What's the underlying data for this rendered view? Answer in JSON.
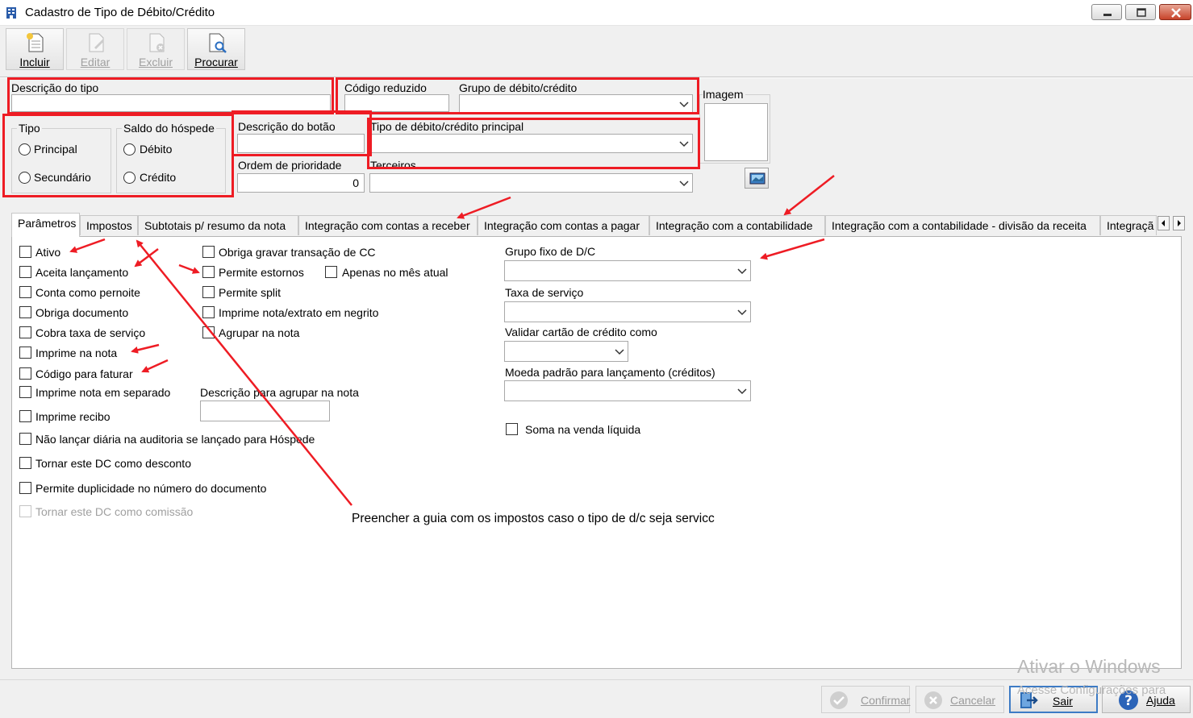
{
  "window": {
    "title": "Cadastro de Tipo de Débito/Crédito"
  },
  "toolbar": {
    "incluir": "Incluir",
    "editar": "Editar",
    "excluir": "Excluir",
    "procurar": "Procurar"
  },
  "form": {
    "descricao_tipo_label": "Descrição do tipo",
    "descricao_tipo_value": "",
    "codigo_reduzido_label": "Código reduzido",
    "codigo_reduzido_value": "",
    "grupo_label": "Grupo de débito/crédito",
    "grupo_value": "",
    "imagem_label": "Imagem",
    "tipo_label": "Tipo",
    "tipo_options": [
      "Principal",
      "Secundário"
    ],
    "saldo_label": "Saldo do hóspede",
    "saldo_options": [
      "Débito",
      "Crédito"
    ],
    "descricao_botao_label": "Descrição do botão",
    "descricao_botao_value": "",
    "tipo_principal_label": "Tipo de débito/crédito principal",
    "tipo_principal_value": "",
    "ordem_label": "Ordem de prioridade",
    "ordem_value": "0",
    "terceiros_label": "Terceiros",
    "terceiros_value": ""
  },
  "tabs": [
    "Parâmetros",
    "Impostos",
    "Subtotais p/ resumo da nota",
    "Integração com contas a receber",
    "Integração com contas a pagar",
    "Integração com a contabilidade",
    "Integração com a contabilidade - divisão da receita",
    "Integraçã"
  ],
  "params": {
    "col1": [
      "Ativo",
      "Aceita lançamento",
      "Conta como pernoite",
      "Obriga documento",
      "Cobra taxa de serviço",
      "Imprime na nota",
      "Código para faturar",
      "Imprime nota em separado",
      "Imprime recibo",
      "Não lançar diária na auditoria se lançado para Hóspede",
      "Tornar este DC como desconto",
      "Permite duplicidade no número do documento",
      "Tornar este DC como comissão"
    ],
    "col2": [
      "Obriga gravar transação de CC",
      "Permite estornos",
      "Permite split",
      "Imprime nota/extrato em negrito",
      "Agrupar na nota"
    ],
    "apenas_mes_atual": "Apenas no mês atual",
    "descricao_agrupar_label": "Descrição para agrupar na nota",
    "descricao_agrupar_value": "",
    "grupo_fixo_label": "Grupo fixo de D/C",
    "taxa_servico_label": "Taxa de serviço",
    "validar_cartao_label": "Validar cartão de crédito como",
    "moeda_label": "Moeda padrão para lançamento (créditos)",
    "soma_venda_label": "Soma na venda líquida"
  },
  "annotation": "Preencher a guia com os impostos caso o tipo de d/c seja servicc",
  "footer": {
    "confirmar": "Confirmar",
    "cancelar": "Cancelar",
    "sair": "Sair",
    "ajuda": "Ajuda"
  },
  "watermark": {
    "line1": "Ativar o Windows",
    "line2": "Acesse Configurações para"
  },
  "colors": {
    "annotation_red": "#ee1c24",
    "focus_blue": "#3d7bc5"
  }
}
